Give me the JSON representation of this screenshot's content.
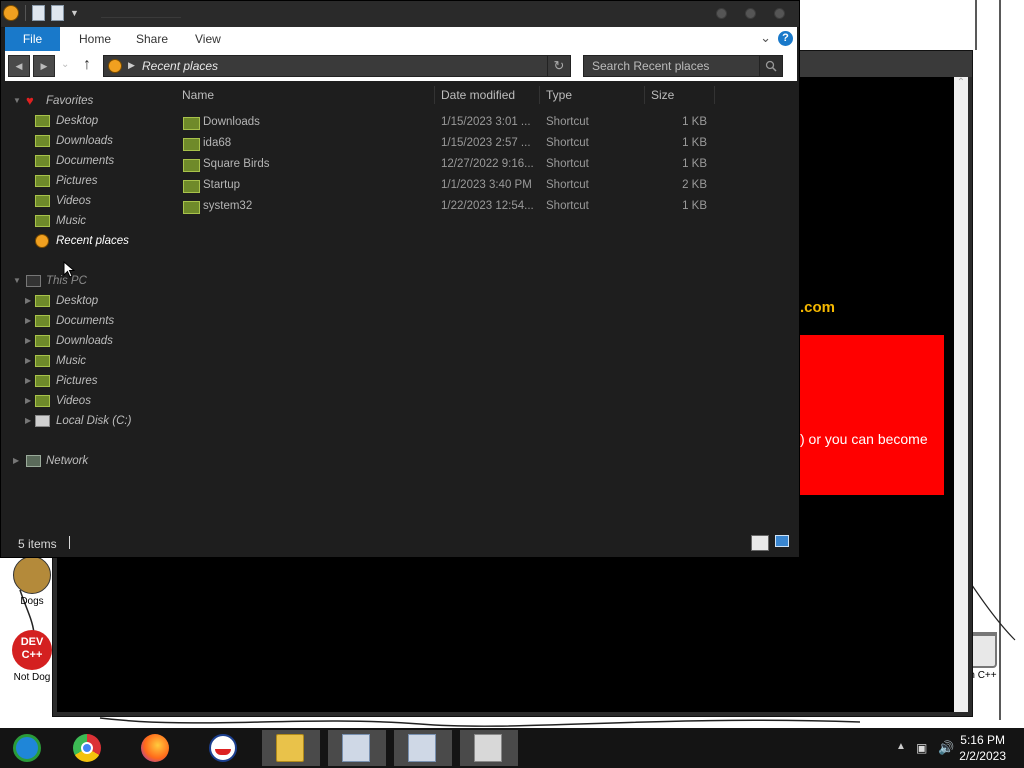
{
  "desktop": {
    "icons": [
      {
        "label": "Dogs"
      },
      {
        "label": "Not Dog"
      },
      {
        "label": "DEV C++"
      },
      {
        "label": "n C++"
      }
    ]
  },
  "background_window": {
    "site_text": ".com",
    "red_box_text": ") or you can become"
  },
  "explorer": {
    "ribbon": {
      "tabs": [
        "File",
        "Home",
        "Share",
        "View"
      ],
      "help_label": "?"
    },
    "address": {
      "path": "Recent places"
    },
    "search": {
      "placeholder": "Search Recent places"
    },
    "nav_pane": {
      "favorites_label": "Favorites",
      "favorites": [
        "Desktop",
        "Downloads",
        "Documents",
        "Pictures",
        "Videos",
        "Music",
        "Recent places"
      ],
      "this_pc_label": "This PC",
      "this_pc": [
        "Desktop",
        "Documents",
        "Downloads",
        "Music",
        "Pictures",
        "Videos",
        "Local Disk (C:)"
      ],
      "network_label": "Network"
    },
    "columns": {
      "name": "Name",
      "date": "Date modified",
      "type": "Type",
      "size": "Size"
    },
    "files": [
      {
        "name": "Downloads",
        "date": "1/15/2023 3:01 ...",
        "type": "Shortcut",
        "size": "1 KB"
      },
      {
        "name": "ida68",
        "date": "1/15/2023 2:57 ...",
        "type": "Shortcut",
        "size": "1 KB"
      },
      {
        "name": "Square Birds",
        "date": "12/27/2022 9:16...",
        "type": "Shortcut",
        "size": "1 KB"
      },
      {
        "name": "Startup",
        "date": "1/1/2023 3:40 PM",
        "type": "Shortcut",
        "size": "2 KB"
      },
      {
        "name": "system32",
        "date": "1/22/2023 12:54...",
        "type": "Shortcut",
        "size": "1 KB"
      }
    ],
    "status": {
      "item_count": "5 items"
    }
  },
  "taskbar": {
    "apps": [
      "start-orb-icon",
      "chrome-icon",
      "firefox-icon",
      "obama-logo-icon",
      "file-explorer-icon",
      "network-config-icon",
      "network-setup-icon",
      "archive-icon"
    ],
    "clock_time": "5:16 PM",
    "clock_date": "2/2/2023"
  },
  "colors": {
    "ribbon_file_tab": "#1979ca",
    "explorer_bg": "#1e1e1e",
    "red_box": "#ff0000",
    "site_text": "#f5b800"
  }
}
